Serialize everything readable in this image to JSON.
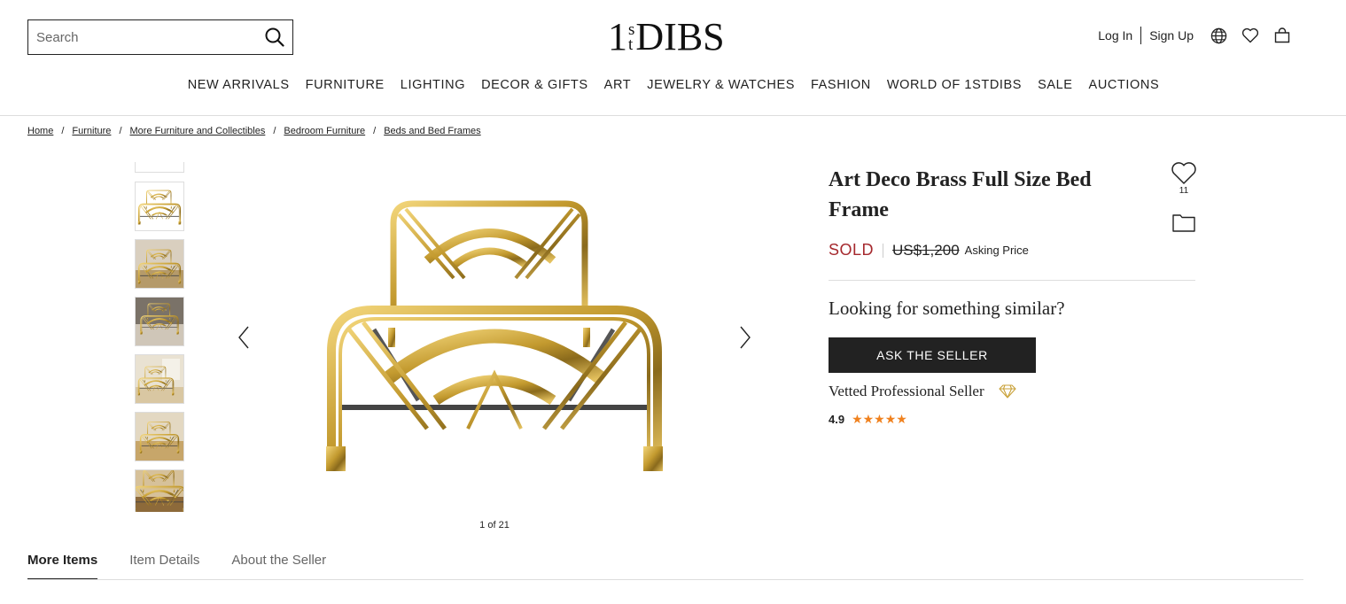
{
  "header": {
    "search_placeholder": "Search",
    "logo": {
      "one": "1",
      "s": "s",
      "t": "t",
      "dibs": "DIBS"
    },
    "login": "Log In",
    "signup": "Sign Up",
    "icons": [
      "globe-icon",
      "heart-icon",
      "bag-icon"
    ]
  },
  "nav": [
    "NEW ARRIVALS",
    "FURNITURE",
    "LIGHTING",
    "DECOR & GIFTS",
    "ART",
    "JEWELRY & WATCHES",
    "FASHION",
    "WORLD OF 1STDIBS",
    "SALE",
    "AUCTIONS"
  ],
  "breadcrumb": [
    "Home",
    "Furniture",
    "More Furniture and Collectibles",
    "Bedroom Furniture",
    "Beds and Bed Frames"
  ],
  "gallery": {
    "counter": "1 of 21"
  },
  "product": {
    "title": "Art Deco Brass Full Size Bed Frame",
    "favorites_count": "11",
    "status": "SOLD",
    "price": "US$1,200",
    "price_label": "Asking Price",
    "similar_heading": "Looking for something similar?",
    "ask_button": "ASK THE SELLER",
    "seller_badge": "Vetted Professional Seller",
    "rating": "4.9",
    "stars": "★★★★★"
  },
  "colors": {
    "sold": "#a5282d",
    "star": "#f0811e",
    "brass": "#c9a23a",
    "button": "#222222"
  },
  "tabs": [
    "More Items",
    "Item Details",
    "About the Seller"
  ]
}
